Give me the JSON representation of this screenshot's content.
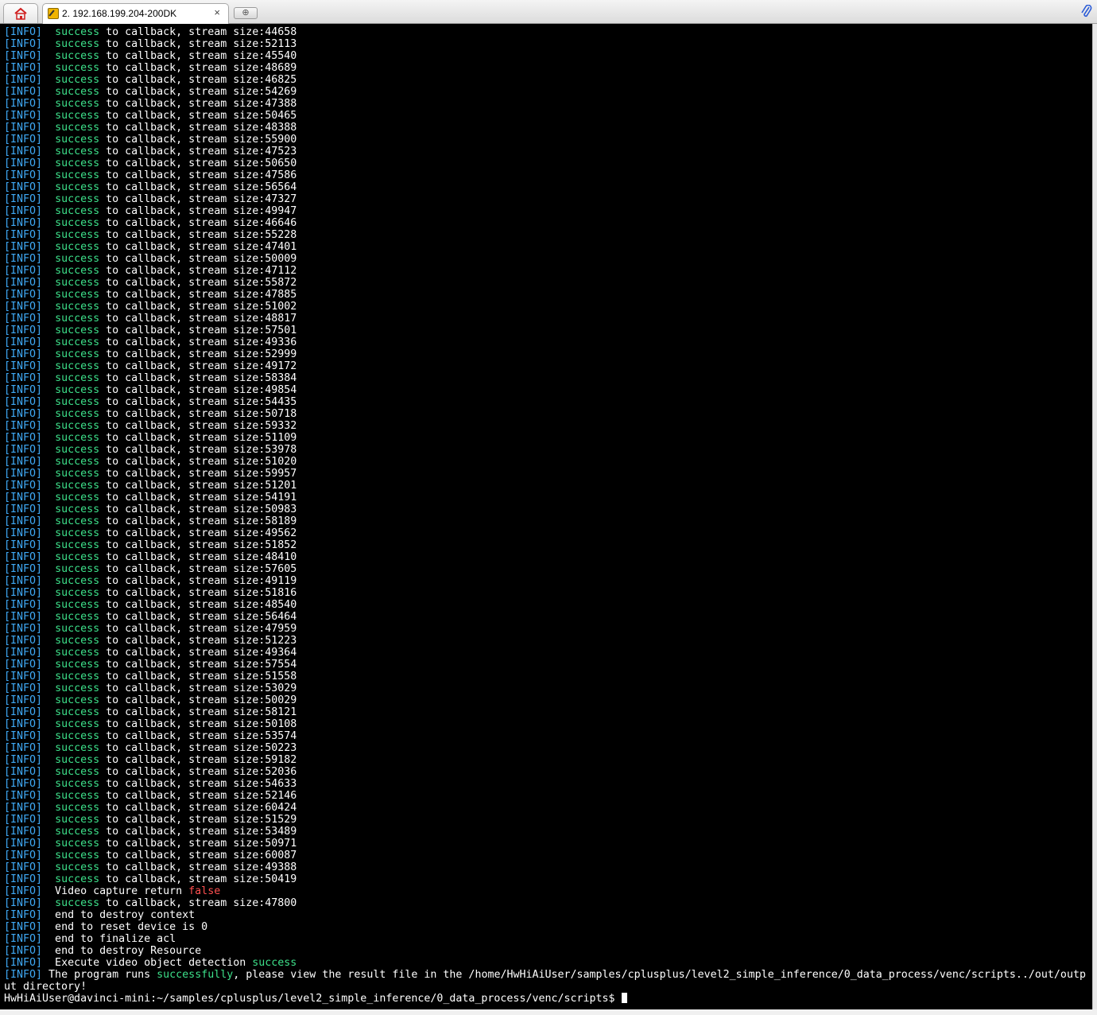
{
  "tabs": {
    "home_icon": "home-icon",
    "session_icon": "terminal-session-icon",
    "session_title": "2. 192.168.199.204-200DK",
    "close_glyph": "×",
    "new_tab_icon": "add-tab-icon",
    "attach_icon": "paperclip-icon"
  },
  "colors": {
    "terminal_bg": "#000000",
    "text": "#ffffff",
    "tag": "#3fa9f5",
    "success": "#3de08a",
    "error": "#ff5050"
  },
  "terminal": {
    "tag": "[INFO]",
    "callback_text": " to callback, stream size:",
    "success_word": "success",
    "stream_sizes": [
      "44658",
      "52113",
      "45540",
      "48689",
      "46825",
      "54269",
      "47388",
      "50465",
      "48388",
      "55900",
      "47523",
      "50650",
      "47586",
      "56564",
      "47327",
      "49947",
      "46646",
      "55228",
      "47401",
      "50009",
      "47112",
      "55872",
      "47885",
      "51002",
      "48817",
      "57501",
      "49336",
      "52999",
      "49172",
      "58384",
      "49854",
      "54435",
      "50718",
      "59332",
      "51109",
      "53978",
      "51020",
      "59957",
      "51201",
      "54191",
      "50983",
      "58189",
      "49562",
      "51852",
      "48410",
      "57605",
      "49119",
      "51816",
      "48540",
      "56464",
      "47959",
      "51223",
      "49364",
      "57554",
      "51558",
      "53029",
      "50029",
      "58121",
      "50108",
      "53574",
      "50223",
      "59182",
      "52036",
      "54633",
      "52146",
      "60424",
      "51529",
      "53489",
      "50971",
      "60087",
      "49388",
      "50419"
    ],
    "video_capture_text": "  Video capture return ",
    "video_capture_value": "false",
    "last_stream_size": "47800",
    "end_lines": [
      "  end to destroy context",
      "  end to reset device is 0",
      "  end to finalize acl",
      "  end to destroy Resource"
    ],
    "execute_text": "  Execute video object detection ",
    "execute_status": "success",
    "program_prefix": " The program runs ",
    "program_status": "successfully",
    "program_suffix_1": ", please view the result file in the /home/HwHiAiUser/samples/cplusplus/level2_simple_inference/0_data_process/venc/scripts../out/outp",
    "program_suffix_2": "ut directory!",
    "prompt": "HwHiAiUser@davinci-mini:~/samples/cplusplus/level2_simple_inference/0_data_process/venc/scripts$ "
  }
}
